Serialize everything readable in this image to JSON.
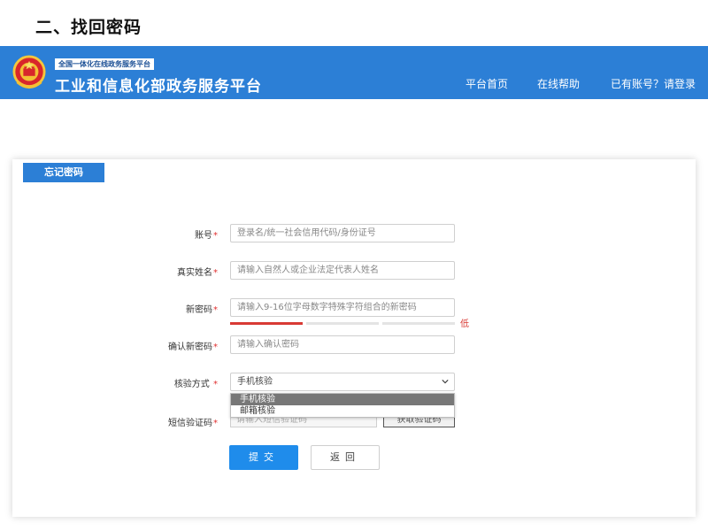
{
  "doc_heading": "二、找回密码",
  "header": {
    "slogan": "全国一体化在线政务服务平台",
    "title": "工业和信息化部政务服务平台",
    "nav": {
      "home": "平台首页",
      "help": "在线帮助",
      "login": "已有账号？请登录"
    }
  },
  "colors": {
    "brand_blue": "#2c7fd6",
    "button_blue": "#1f8ceb",
    "required_red": "#e03030"
  },
  "form": {
    "tab_label": "忘记密码",
    "required_mark": "*",
    "account": {
      "label": "账号",
      "placeholder": "登录名/统一社会信用代码/身份证号"
    },
    "real_name": {
      "label": "真实姓名",
      "placeholder": "请输入自然人或企业法定代表人姓名"
    },
    "new_password": {
      "label": "新密码",
      "placeholder": "请输入9-16位字母数字特殊字符组合的新密码",
      "strength_text": "低",
      "strength_level": 1,
      "strength_max": 3
    },
    "confirm_password": {
      "label": "确认新密码",
      "placeholder": "请输入确认密码"
    },
    "verify_method": {
      "label": "核验方式",
      "selected": "手机核验",
      "options": [
        "手机核验",
        "邮箱核验"
      ]
    },
    "sms_code": {
      "label": "短信验证码",
      "placeholder": "请输入短信验证码",
      "send_button": "获取验证码"
    },
    "submit": "提交",
    "back": "返回"
  }
}
